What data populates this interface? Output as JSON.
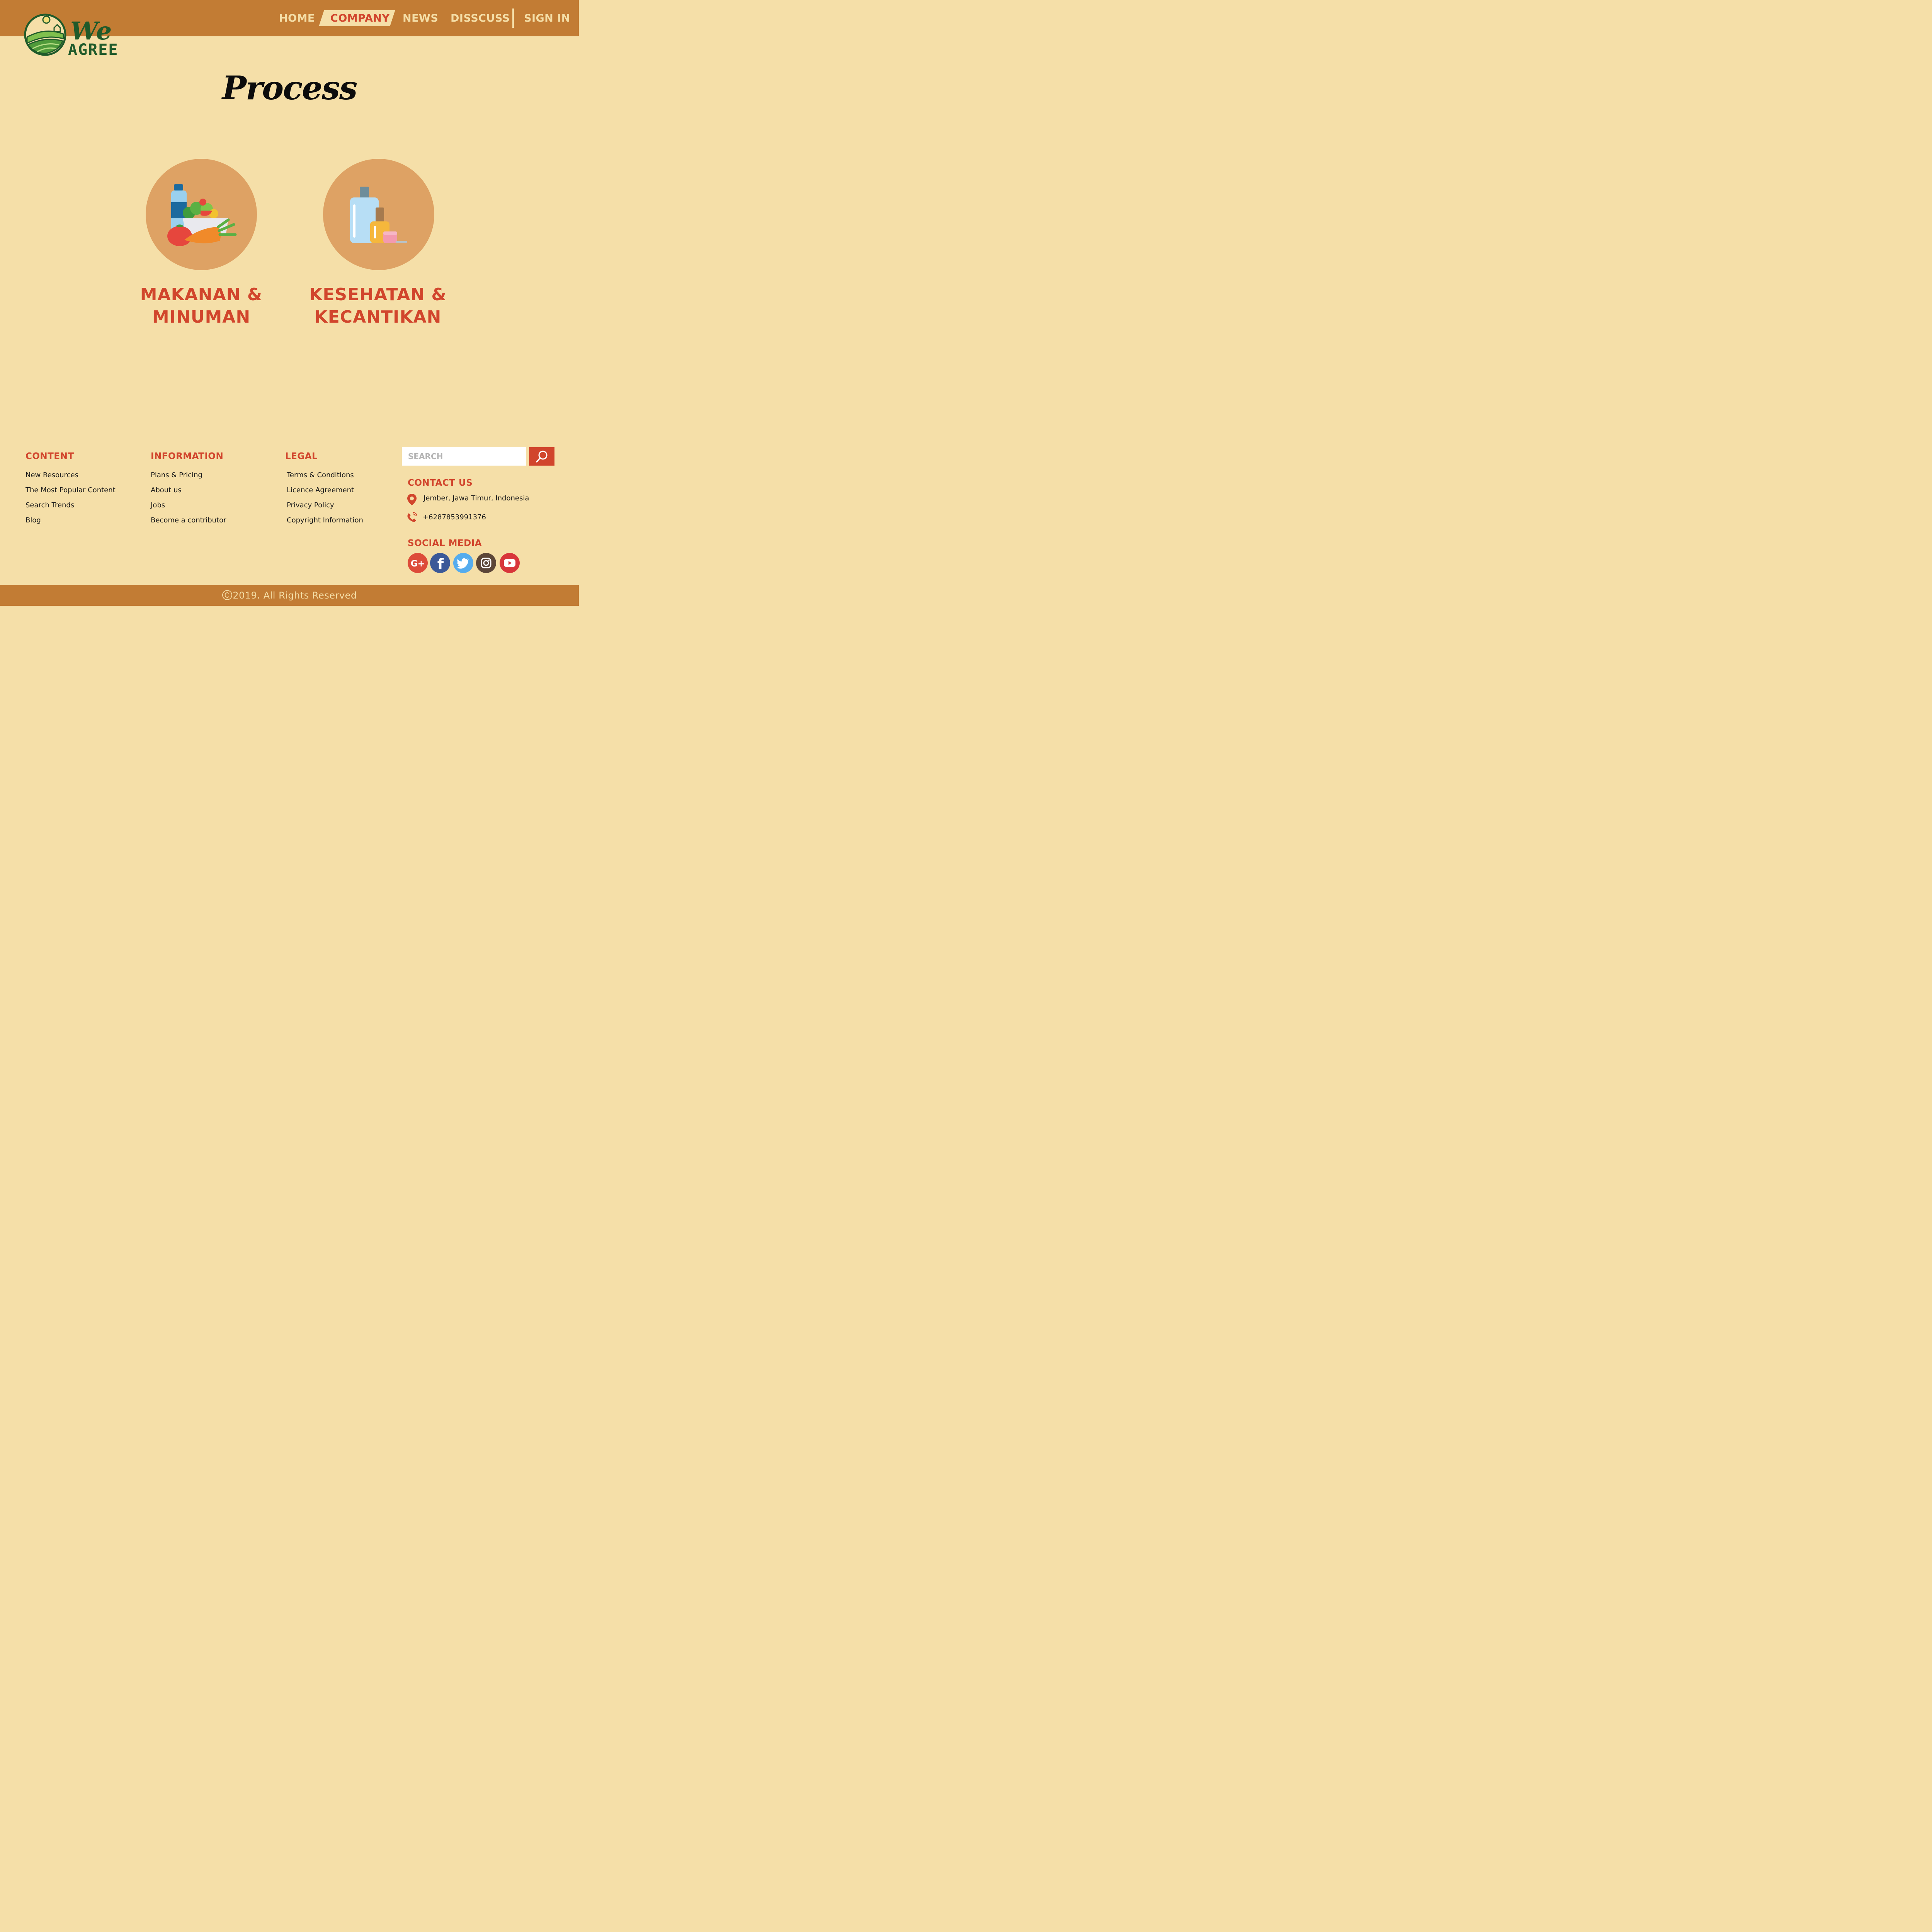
{
  "brand": {
    "line1": "We",
    "line2": "AGREE"
  },
  "nav": {
    "home": "HOME",
    "company": "COMPANY",
    "news": "NEWS",
    "discuss": "DISSCUSS",
    "signin": "SIGN IN",
    "active": "company"
  },
  "page": {
    "title": "Process"
  },
  "categories": [
    {
      "line1": "MAKANAN &",
      "line2": "MINUMAN",
      "icon": "food-and-drink-icon"
    },
    {
      "line1": "KESEHATAN &",
      "line2": "KECANTIKAN",
      "icon": "cosmetics-icon"
    }
  ],
  "footer": {
    "content": {
      "heading": "CONTENT",
      "links": [
        "New Resources",
        "The Most Popular Content",
        "Search Trends",
        "Blog"
      ]
    },
    "information": {
      "heading": "INFORMATION",
      "links": [
        "Plans & Pricing",
        "About us",
        "Jobs",
        "Become a contributor"
      ]
    },
    "legal": {
      "heading": "LEGAL",
      "links": [
        "Terms & Conditions",
        "Licence Agreement",
        "Privacy Policy",
        "Copyright Information"
      ]
    },
    "search": {
      "placeholder": "SEARCH",
      "value": ""
    },
    "contact": {
      "heading": "CONTACT US",
      "address": "Jember, Jawa Timur, Indonesia",
      "phone": "+6287853991376"
    },
    "social": {
      "heading": "SOCIAL MEDIA",
      "items": [
        {
          "name": "google-plus-icon",
          "label": "G+",
          "color": "#dd4b39"
        },
        {
          "name": "facebook-icon",
          "label": "f",
          "color": "#3b5998"
        },
        {
          "name": "twitter-icon",
          "label": "",
          "color": "#55acee"
        },
        {
          "name": "instagram-icon",
          "label": "",
          "color": "#5c4638"
        },
        {
          "name": "youtube-icon",
          "label": "",
          "color": "#d8363a"
        }
      ]
    },
    "copyright": "2019. All Rights Reserved"
  },
  "colors": {
    "background": "#f5dfa8",
    "header": "#c27c34",
    "accent": "#d1452c",
    "circle": "#dea264",
    "logo_green": "#1f5a2a"
  }
}
